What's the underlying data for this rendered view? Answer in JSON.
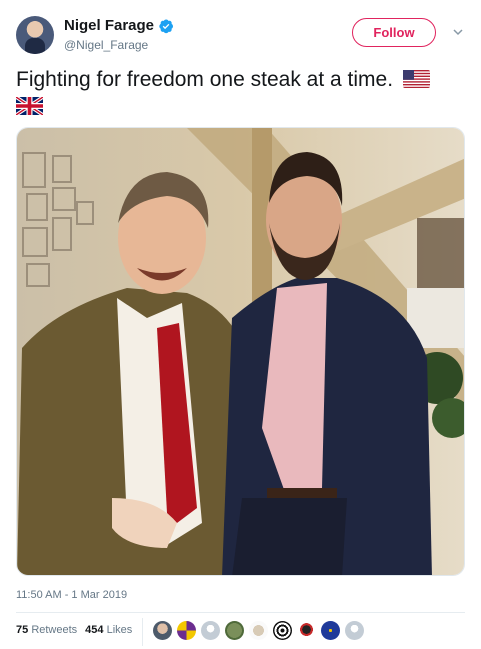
{
  "user": {
    "display_name": "Nigel Farage",
    "handle": "@Nigel_Farage",
    "avatar_icon": "user-avatar",
    "verified_icon": "verified-badge-icon",
    "verified_color": "#1da1f2"
  },
  "actions": {
    "follow_label": "Follow",
    "follow_color": "#e0245e",
    "menu_icon": "chevron-down-icon"
  },
  "tweet": {
    "text": "Fighting for freedom one steak at a time.",
    "emoji": [
      "us-flag-icon",
      "uk-flag-icon"
    ]
  },
  "media": {
    "icon": "tweet-photo"
  },
  "meta": {
    "timestamp": "11:50 AM - 1 Mar 2019"
  },
  "stats": {
    "retweets_count": "75",
    "retweets_label": "Retweets",
    "likes_count": "454",
    "likes_label": "Likes"
  },
  "likers": [
    "liker-avatar-1",
    "liker-avatar-2",
    "liker-avatar-3",
    "liker-avatar-4",
    "liker-avatar-5",
    "liker-avatar-6",
    "liker-avatar-7",
    "liker-avatar-8",
    "liker-avatar-9"
  ]
}
